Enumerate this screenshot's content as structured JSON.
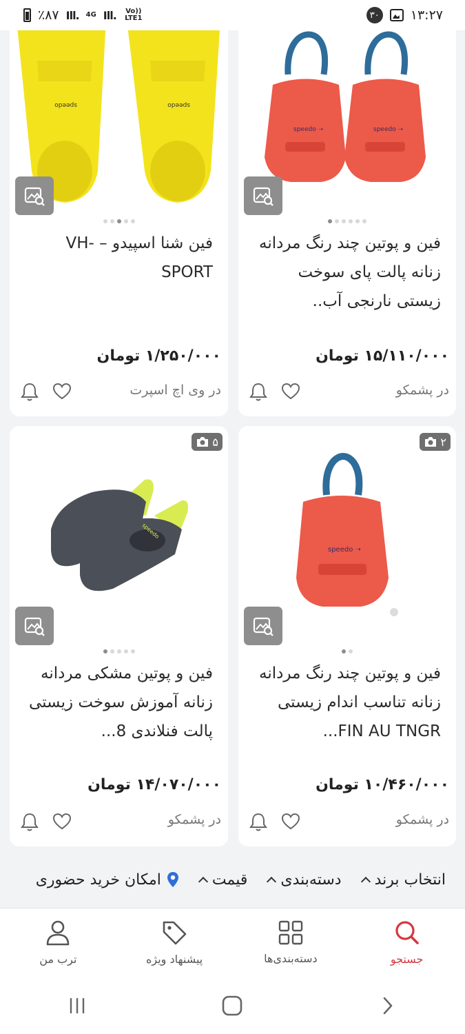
{
  "status_bar": {
    "battery": "٪۸۷",
    "network": "4G",
    "volte": "Vo)) LTE1",
    "notification_count": "۳۰",
    "time": "۱۳:۲۷"
  },
  "products": [
    {
      "title": "فین و پوتین چند رنگ مردانه زنانه پالت پای سوخت زیستی نارنجی آب..",
      "price": "۱۵/۱۱۰/۰۰۰ تومان",
      "seller": "در پشمکو",
      "dots_total": 6,
      "dot_active": 0,
      "photo_count": ""
    },
    {
      "title": "فین شنا اسپیدو – VH- SPORT",
      "price": "۱/۲۵۰/۰۰۰ تومان",
      "seller": "در وی اچ اسپرت",
      "dots_total": 5,
      "dot_active": 2,
      "photo_count": ""
    },
    {
      "title": "فین و پوتین چند رنگ مردانه زنانه تناسب اندام زیستی FIN AU TNGR...",
      "price": "۱۰/۴۶۰/۰۰۰ تومان",
      "seller": "در پشمکو",
      "dots_total": 2,
      "dot_active": 0,
      "photo_count": "۲"
    },
    {
      "title": "فین و پوتین مشکی مردانه زنانه آموزش سوخت زیستی پالت فنلاندی 8...",
      "price": "۱۴/۰۷۰/۰۰۰ تومان",
      "seller": "در پشمکو",
      "dots_total": 5,
      "dot_active": 0,
      "photo_count": "۵"
    }
  ],
  "filters": {
    "brand": "انتخاب برند",
    "category": "دسته‌بندی",
    "price": "قیمت",
    "in_person": "امکان خرید حضوری"
  },
  "bottom_nav": {
    "search": "جستجو",
    "categories": "دسته‌بندی‌ها",
    "offers": "پیشنهاد ویژه",
    "profile": "ترب من"
  },
  "colors": {
    "accent": "#d2393f",
    "yellow_fin": "#f3e31c",
    "red_fin": "#ec5a4a",
    "strap_blue": "#2e6c9a",
    "grey_fin": "#4b4f57",
    "lime_fin": "#d8ec52"
  }
}
